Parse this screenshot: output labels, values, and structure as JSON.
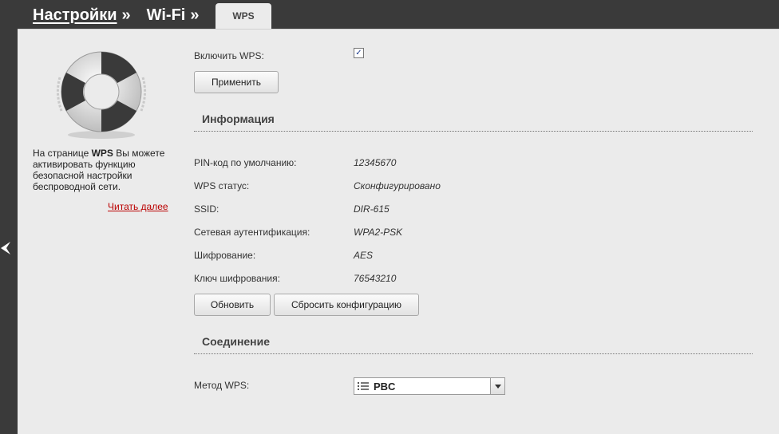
{
  "breadcrumb": {
    "items": [
      {
        "label": "Настройки",
        "sep": "»"
      },
      {
        "label": "Wi-Fi",
        "sep": "»"
      }
    ]
  },
  "tab": {
    "label": "WPS"
  },
  "sidebar": {
    "help_prefix": "На странице ",
    "help_bold": "WPS",
    "help_suffix": " Вы можете активировать функцию безопасной настройки беспроводной сети.",
    "read_more": "Читать далее"
  },
  "enable": {
    "label": "Включить WPS:",
    "checked": true,
    "check_glyph": "✓"
  },
  "apply_button": "Применить",
  "info": {
    "title": "Информация",
    "rows": [
      {
        "label": "PIN-код по умолчанию:",
        "value": "12345670"
      },
      {
        "label": "WPS статус:",
        "value": "Сконфигурировано"
      },
      {
        "label": "SSID:",
        "value": "DIR-615"
      },
      {
        "label": "Сетевая аутентификация:",
        "value": "WPA2-PSK"
      },
      {
        "label": "Шифрование:",
        "value": "AES"
      },
      {
        "label": "Ключ шифрования:",
        "value": "76543210"
      }
    ],
    "refresh_button": "Обновить",
    "reset_button": "Сбросить конфигурацию"
  },
  "connection": {
    "title": "Соединение",
    "method_label": "Метод WPS:",
    "method_value": "PBC"
  }
}
